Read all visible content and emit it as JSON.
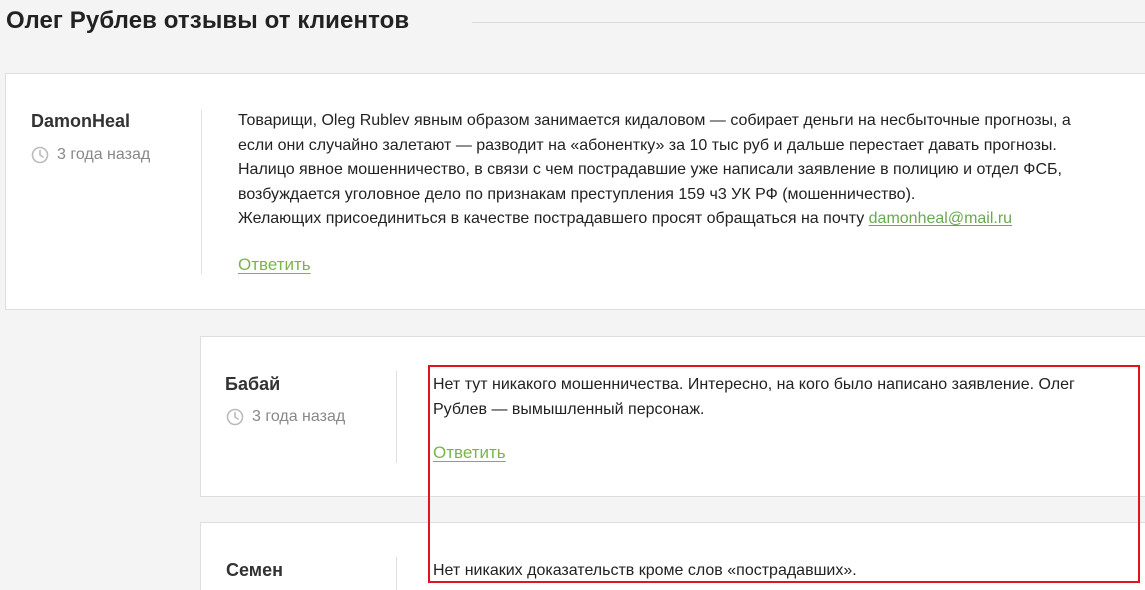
{
  "page": {
    "title": "Олег Рублев отзывы от клиентов"
  },
  "comments": [
    {
      "author": "DamonHeal",
      "time_ago": "3 года назад",
      "lines": [
        "Товарищи, Oleg Rublev явным образом занимается кидаловом — собирает деньги на несбыточные прогнозы, а",
        "если они случайно залетают — разводит на «абонентку» за 10 тыс руб и дальше перестает давать прогнозы.",
        "Налицо явное мошенничество, в связи с чем пострадавшие уже написали заявление в полицию и отдел ФСБ,",
        "возбуждается уголовное дело по признакам преступления 159 ч3 УК РФ (мошенничество)."
      ],
      "last_line_prefix": "Желающих присоединиться в качестве пострадавшего просят обращаться на почту ",
      "email": "damonheal@mail.ru",
      "reply_label": "Ответить"
    },
    {
      "author": "Бабай",
      "time_ago": "3 года назад",
      "lines": [
        "Нет тут никакого мошенничества. Интересно, на кого было написано заявление. Олег",
        "Рублев — вымышленный персонаж."
      ],
      "reply_label": "Ответить"
    },
    {
      "author": "Семен",
      "lines": [
        "Нет никаких доказательств кроме слов «пострадавших»."
      ]
    }
  ],
  "colors": {
    "link": "#6aa84f",
    "highlight": "#e0141e"
  },
  "icons": {
    "time": "clock-icon"
  }
}
